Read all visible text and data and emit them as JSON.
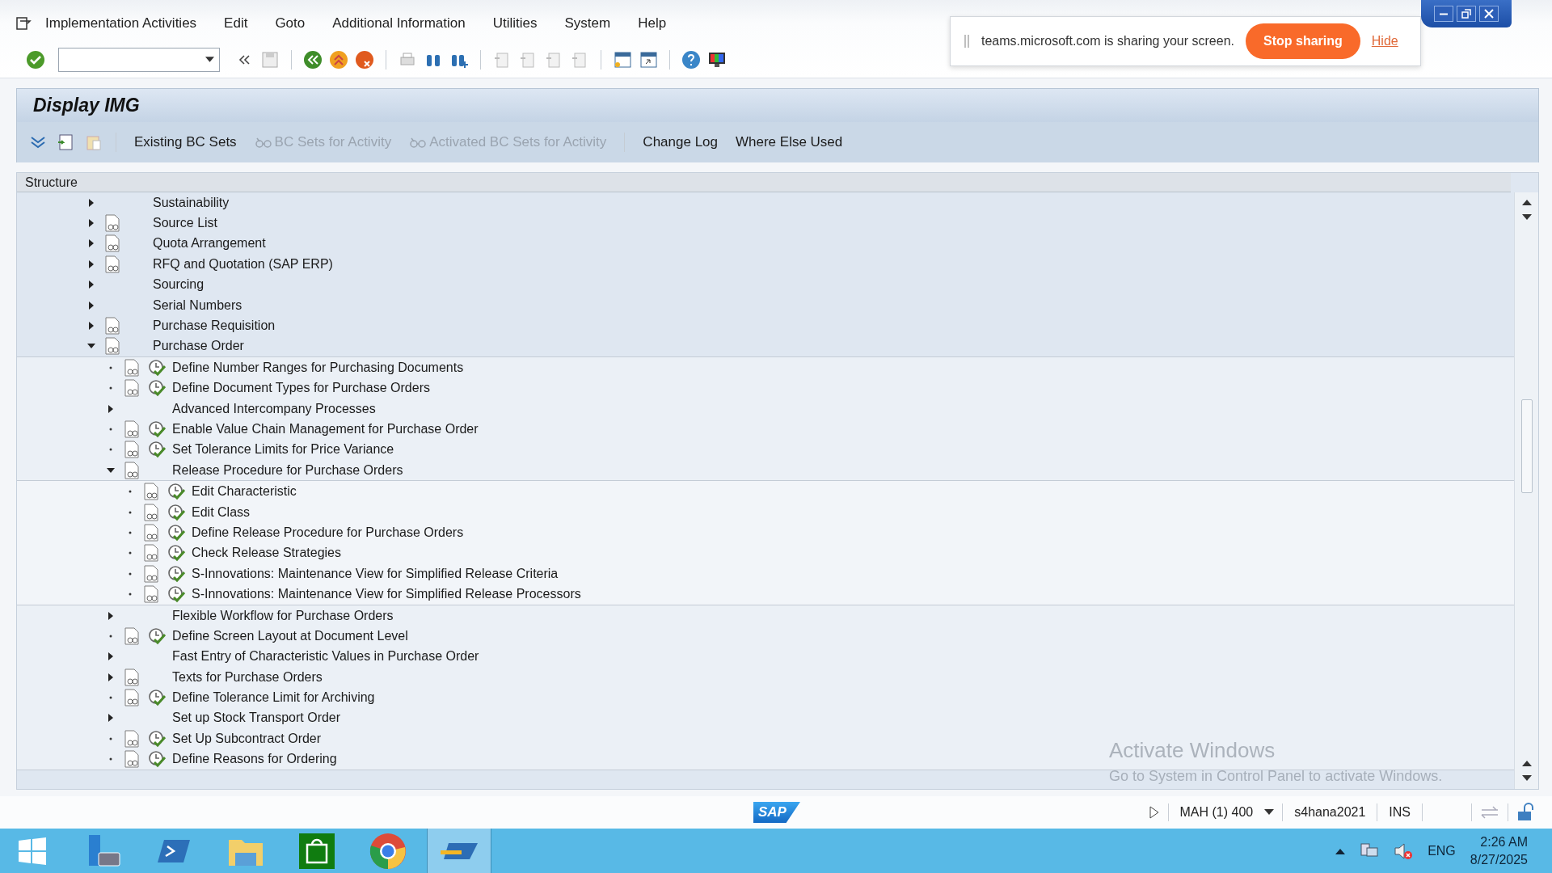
{
  "menu": [
    "Implementation Activities",
    "Edit",
    "Goto",
    "Additional Information",
    "Utilities",
    "System",
    "Help"
  ],
  "screen_share": {
    "message": "teams.microsoft.com is sharing your screen.",
    "stop_button": "Stop sharing",
    "hide_link": "Hide"
  },
  "title": "Display IMG",
  "app_toolbar": [
    {
      "label": "Existing BC Sets",
      "disabled": false,
      "icon": false
    },
    {
      "label": "BC Sets for Activity",
      "disabled": true,
      "icon": true
    },
    {
      "label": "Activated BC Sets for Activity",
      "disabled": true,
      "icon": true
    },
    {
      "label": "Change Log",
      "disabled": false,
      "icon": false
    },
    {
      "label": "Where Else Used",
      "disabled": false,
      "icon": false
    }
  ],
  "tree_header": "Structure",
  "tree": [
    {
      "label": "Sustainability",
      "kind": "folder",
      "doc_icon": false,
      "expanded": false
    },
    {
      "label": "Source List",
      "kind": "folder",
      "doc_icon": true,
      "expanded": false
    },
    {
      "label": "Quota Arrangement",
      "kind": "folder",
      "doc_icon": true,
      "expanded": false
    },
    {
      "label": "RFQ and Quotation (SAP ERP)",
      "kind": "folder",
      "doc_icon": true,
      "expanded": false
    },
    {
      "label": "Sourcing",
      "kind": "folder",
      "doc_icon": false,
      "expanded": false
    },
    {
      "label": "Serial Numbers",
      "kind": "folder",
      "doc_icon": false,
      "expanded": false
    },
    {
      "label": "Purchase Requisition",
      "kind": "folder",
      "doc_icon": true,
      "expanded": false
    },
    {
      "label": "Purchase Order",
      "kind": "folder",
      "doc_icon": true,
      "expanded": true,
      "children": [
        {
          "label": "Define Number Ranges for Purchasing Documents",
          "kind": "activity"
        },
        {
          "label": "Define Document Types for Purchase Orders",
          "kind": "activity"
        },
        {
          "label": "Advanced Intercompany Processes",
          "kind": "folder",
          "doc_icon": false,
          "expanded": false
        },
        {
          "label": "Enable Value Chain Management for Purchase Order",
          "kind": "activity"
        },
        {
          "label": "Set Tolerance Limits for Price Variance",
          "kind": "activity"
        },
        {
          "label": "Release Procedure for Purchase Orders",
          "kind": "folder",
          "doc_icon": true,
          "expanded": true,
          "children": [
            {
              "label": "Edit Characteristic",
              "kind": "activity"
            },
            {
              "label": "Edit Class",
              "kind": "activity"
            },
            {
              "label": "Define Release Procedure for Purchase Orders",
              "kind": "activity"
            },
            {
              "label": "Check Release Strategies",
              "kind": "activity"
            },
            {
              "label": "S-Innovations: Maintenance View for Simplified Release Criteria",
              "kind": "activity"
            },
            {
              "label": "S-Innovations: Maintenance View for Simplified Release Processors",
              "kind": "activity"
            }
          ]
        },
        {
          "label": "Flexible Workflow for Purchase Orders",
          "kind": "folder",
          "doc_icon": false,
          "expanded": false
        },
        {
          "label": "Define Screen Layout at Document Level",
          "kind": "activity"
        },
        {
          "label": "Fast Entry of Characteristic Values in Purchase Order",
          "kind": "folder",
          "doc_icon": false,
          "expanded": false
        },
        {
          "label": "Texts for Purchase Orders",
          "kind": "folder",
          "doc_icon": true,
          "expanded": false
        },
        {
          "label": "Define Tolerance Limit for Archiving",
          "kind": "activity"
        },
        {
          "label": "Set up Stock Transport Order",
          "kind": "folder",
          "doc_icon": false,
          "expanded": false
        },
        {
          "label": "Set Up Subcontract Order",
          "kind": "activity"
        },
        {
          "label": "Define Reasons for Ordering",
          "kind": "activity"
        }
      ]
    }
  ],
  "activation_notice": {
    "title": "Activate Windows",
    "text": "Go to System in Control Panel to activate Windows."
  },
  "status_bar": {
    "logo": "SAP",
    "session": "MAH (1) 400",
    "server": "s4hana2021",
    "mode": "INS"
  },
  "taskbar": {
    "language": "ENG",
    "time": "2:26 AM",
    "date": "8/27/2025"
  }
}
